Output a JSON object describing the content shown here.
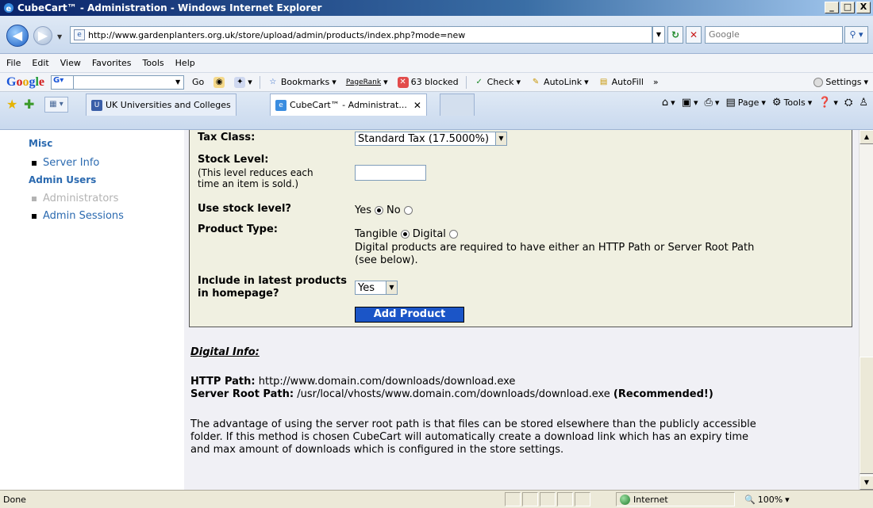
{
  "window": {
    "title": "CubeCart™ - Administration - Windows Internet Explorer",
    "min": "_",
    "max": "□",
    "close": "X"
  },
  "address": {
    "url": "http://www.gardenplanters.org.uk/store/upload/admin/products/index.php?mode=new",
    "search_placeholder": "Google"
  },
  "menu": [
    "File",
    "Edit",
    "View",
    "Favorites",
    "Tools",
    "Help"
  ],
  "google_toolbar": {
    "go": "Go",
    "bookmarks": "Bookmarks",
    "pagerank": "PageRank",
    "blocked": "63 blocked",
    "check": "Check",
    "autolink": "AutoLink",
    "autofill": "AutoFill",
    "more": "»",
    "settings": "Settings"
  },
  "tabs": [
    {
      "label": "UK Universities and Colleges",
      "active": false
    },
    {
      "label": "CubeCart™ - Administrat...",
      "active": true
    }
  ],
  "commandbar": {
    "page": "Page",
    "tools": "Tools"
  },
  "sidebar": {
    "misc_heading": "Misc",
    "server_info": "Server Info",
    "admin_users_heading": "Admin Users",
    "administrators": "Administrators",
    "admin_sessions": "Admin Sessions"
  },
  "form": {
    "tax_class_label": "Tax Class:",
    "tax_class_value": "Standard Tax (17.5000%)",
    "stock_level_label": "Stock Level:",
    "stock_level_note_1": "(This level reduces each",
    "stock_level_note_2": "time an item is sold.)",
    "use_stock_label": "Use stock level?",
    "use_stock_yes": "Yes",
    "use_stock_no": "No",
    "product_type_label": "Product Type:",
    "product_type_tangible": "Tangible",
    "product_type_digital": "Digital",
    "product_type_note_1": "Digital products are required to have either an HTTP Path or Server Root Path",
    "product_type_note_2": "(see below).",
    "latest_label_1": "Include in latest products",
    "latest_label_2": "in homepage?",
    "latest_value": "Yes",
    "submit": "Add Product"
  },
  "digital_info": {
    "title": "Digital Info:",
    "http_label": "HTTP Path:",
    "http_value": "http://www.domain.com/downloads/download.exe",
    "root_label": "Server Root Path:",
    "root_value": "/usr/local/vhosts/www.domain.com/downloads/download.exe",
    "recommended": "(Recommended!)",
    "para_1": "The advantage of using the server root path is that files can be stored elsewhere than the publicly accessible",
    "para_2": "folder. If this method is chosen CubeCart will automatically create a download link which has an expiry time",
    "para_3": "and max amount of downloads which is configured in the store settings."
  },
  "status": {
    "text": "Done",
    "zone": "Internet",
    "zoom": "100%"
  }
}
